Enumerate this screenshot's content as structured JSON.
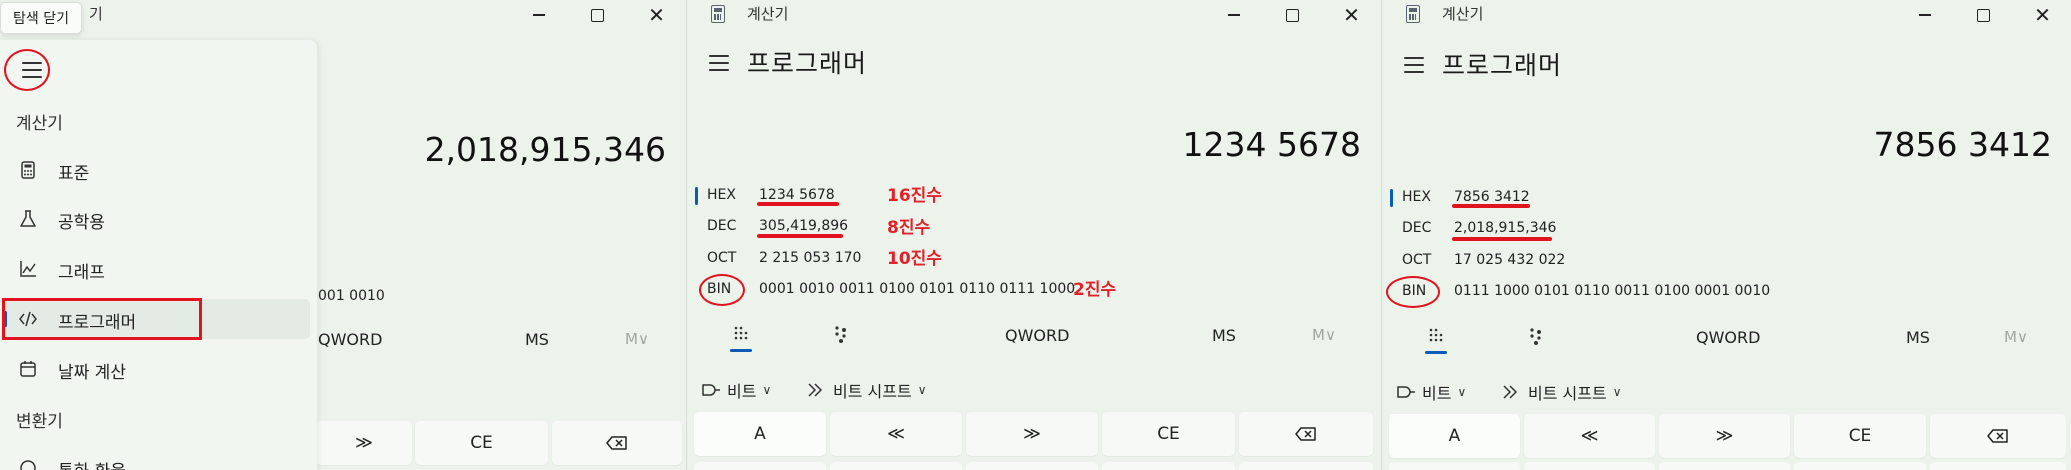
{
  "colors": {
    "accent": "#0a5bb5",
    "annotation_red": "#e0131f"
  },
  "panel1": {
    "tooltip": "탐색 닫기",
    "window_title_fragment": "기",
    "display_value": "2,018,915,346",
    "bin_fragment": "001 0010",
    "word_size": "QWORD",
    "ms": "MS",
    "mdrop": "M∨",
    "keys": [
      "≫",
      "CE",
      "⌫"
    ],
    "nav": {
      "section_calculator": "계산기",
      "items": [
        {
          "label": "표준",
          "icon": "calculator-icon"
        },
        {
          "label": "공학용",
          "icon": "flask-icon"
        },
        {
          "label": "그래프",
          "icon": "graph-icon"
        },
        {
          "label": "프로그래머",
          "icon": "code-icon"
        },
        {
          "label": "날짜 계산",
          "icon": "calendar-icon"
        }
      ],
      "section_converter": "변환기",
      "partial_item": "통화 환율"
    }
  },
  "panel2": {
    "window_title": "계산기",
    "mode_title": "프로그래머",
    "display_value": "1234 5678",
    "radix": [
      {
        "label": "HEX",
        "value": "1234 5678"
      },
      {
        "label": "DEC",
        "value": "305,419,896"
      },
      {
        "label": "OCT",
        "value": "2 215 053 170"
      },
      {
        "label": "BIN",
        "value": "0001 0010 0011 0100 0101 0110 0111 1000"
      }
    ],
    "annotations": [
      "16진수",
      "8진수",
      "10진수",
      "2진수"
    ],
    "word_size": "QWORD",
    "ms": "MS",
    "mdrop": "M∨",
    "bitwise": "비트",
    "bitshift": "비트 시프트",
    "keys": [
      "A",
      "≪",
      "≫",
      "CE",
      "⌫"
    ]
  },
  "panel3": {
    "window_title": "계산기",
    "mode_title": "프로그래머",
    "display_value": "7856 3412",
    "radix": [
      {
        "label": "HEX",
        "value": "7856 3412"
      },
      {
        "label": "DEC",
        "value": "2,018,915,346"
      },
      {
        "label": "OCT",
        "value": "17 025 432 022"
      },
      {
        "label": "BIN",
        "value": "0111 1000 0101 0110 0011 0100 0001 0010"
      }
    ],
    "word_size": "QWORD",
    "ms": "MS",
    "mdrop": "M∨",
    "bitwise": "비트",
    "bitshift": "비트 시프트",
    "keys": [
      "A",
      "≪",
      "≫",
      "CE",
      "⌫"
    ]
  }
}
